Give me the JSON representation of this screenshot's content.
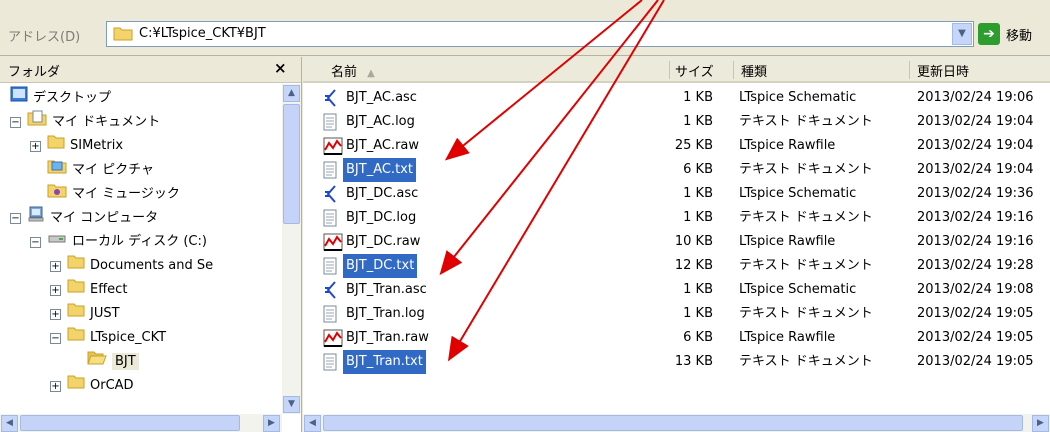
{
  "address_bar": {
    "label": "アドレス(D)",
    "path": "C:¥LTspice_CKT¥BJT",
    "go_label": "移動"
  },
  "tree": {
    "title": "フォルダ",
    "close": "×",
    "items": [
      {
        "label": "デスクトップ",
        "icon": "desktop-icon",
        "expander": ""
      },
      {
        "label": "マイ ドキュメント",
        "icon": "my-documents-icon",
        "expander": "−"
      },
      {
        "label": "SIMetrix",
        "icon": "folder-icon",
        "expander": "+"
      },
      {
        "label": "マイ ピクチャ",
        "icon": "my-pictures-icon",
        "expander": ""
      },
      {
        "label": "マイ ミュージック",
        "icon": "my-music-icon",
        "expander": ""
      },
      {
        "label": "マイ コンピュータ",
        "icon": "my-computer-icon",
        "expander": "−"
      },
      {
        "label": "ローカル ディスク (C:)",
        "icon": "disk-drive-icon",
        "expander": "−"
      },
      {
        "label": "Documents and Se",
        "icon": "folder-icon",
        "expander": "+"
      },
      {
        "label": "Effect",
        "icon": "folder-icon",
        "expander": "+"
      },
      {
        "label": "JUST",
        "icon": "folder-icon",
        "expander": "+"
      },
      {
        "label": "LTspice_CKT",
        "icon": "folder-icon",
        "expander": "−"
      },
      {
        "label": "BJT",
        "icon": "folder-open-icon",
        "expander": ""
      },
      {
        "label": "OrCAD",
        "icon": "folder-icon",
        "expander": "+"
      }
    ]
  },
  "list": {
    "columns": {
      "name": "名前",
      "size": "サイズ",
      "type": "種類",
      "date": "更新日時"
    },
    "files": [
      {
        "name": "BJT_AC.asc",
        "size": "1 KB",
        "type": "LTspice Schematic",
        "date": "2013/02/24 19:06",
        "icon": "ltspice-schematic-icon",
        "selected": false
      },
      {
        "name": "BJT_AC.log",
        "size": "1 KB",
        "type": "テキスト ドキュメント",
        "date": "2013/02/24 19:04",
        "icon": "text-document-icon",
        "selected": false
      },
      {
        "name": "BJT_AC.raw",
        "size": "25 KB",
        "type": "LTspice Rawfile",
        "date": "2013/02/24 19:04",
        "icon": "ltspice-rawfile-icon",
        "selected": false
      },
      {
        "name": "BJT_AC.txt",
        "size": "6 KB",
        "type": "テキスト ドキュメント",
        "date": "2013/02/24 19:04",
        "icon": "text-document-icon",
        "selected": true
      },
      {
        "name": "BJT_DC.asc",
        "size": "1 KB",
        "type": "LTspice Schematic",
        "date": "2013/02/24 19:36",
        "icon": "ltspice-schematic-icon",
        "selected": false
      },
      {
        "name": "BJT_DC.log",
        "size": "1 KB",
        "type": "テキスト ドキュメント",
        "date": "2013/02/24 19:16",
        "icon": "text-document-icon",
        "selected": false
      },
      {
        "name": "BJT_DC.raw",
        "size": "10 KB",
        "type": "LTspice Rawfile",
        "date": "2013/02/24 19:16",
        "icon": "ltspice-rawfile-icon",
        "selected": false
      },
      {
        "name": "BJT_DC.txt",
        "size": "12 KB",
        "type": "テキスト ドキュメント",
        "date": "2013/02/24 19:28",
        "icon": "text-document-icon",
        "selected": true
      },
      {
        "name": "BJT_Tran.asc",
        "size": "1 KB",
        "type": "LTspice Schematic",
        "date": "2013/02/24 19:08",
        "icon": "ltspice-schematic-icon",
        "selected": false
      },
      {
        "name": "BJT_Tran.log",
        "size": "1 KB",
        "type": "テキスト ドキュメント",
        "date": "2013/02/24 19:05",
        "icon": "text-document-icon",
        "selected": false
      },
      {
        "name": "BJT_Tran.raw",
        "size": "6 KB",
        "type": "LTspice Rawfile",
        "date": "2013/02/24 19:05",
        "icon": "ltspice-rawfile-icon",
        "selected": false
      },
      {
        "name": "BJT_Tran.txt",
        "size": "13 KB",
        "type": "テキスト ドキュメント",
        "date": "2013/02/24 19:05",
        "icon": "text-document-icon",
        "selected": true
      }
    ]
  },
  "colors": {
    "selection": "#316ac5",
    "annotation_arrow": "#e00000",
    "folder": "#f4d36b"
  }
}
